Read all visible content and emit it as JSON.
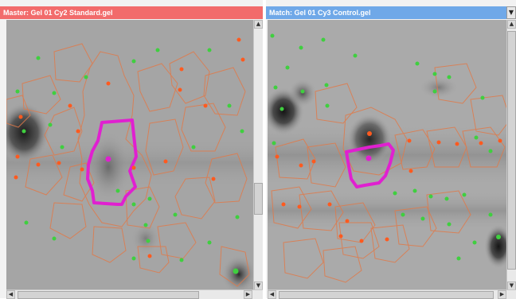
{
  "master": {
    "title": "Master: Gel 01 Cy2 Standard.gel",
    "color": "#f26b6b"
  },
  "match": {
    "title": "Match: Gel 01 Cy3 Control.gel",
    "color": "#6fa8e8",
    "dropdown_icon": "chevron-down-icon"
  },
  "scroll_icons": {
    "up": "▲",
    "down": "▼",
    "left": "◀",
    "right": "▶"
  },
  "colors": {
    "gel_background": "#a3a3a3",
    "spot_outline": "#e07a4a",
    "spot_center": "#ff5a1f",
    "matched_spot": "#3fcf3f",
    "selected_spot": "#e020d0"
  }
}
